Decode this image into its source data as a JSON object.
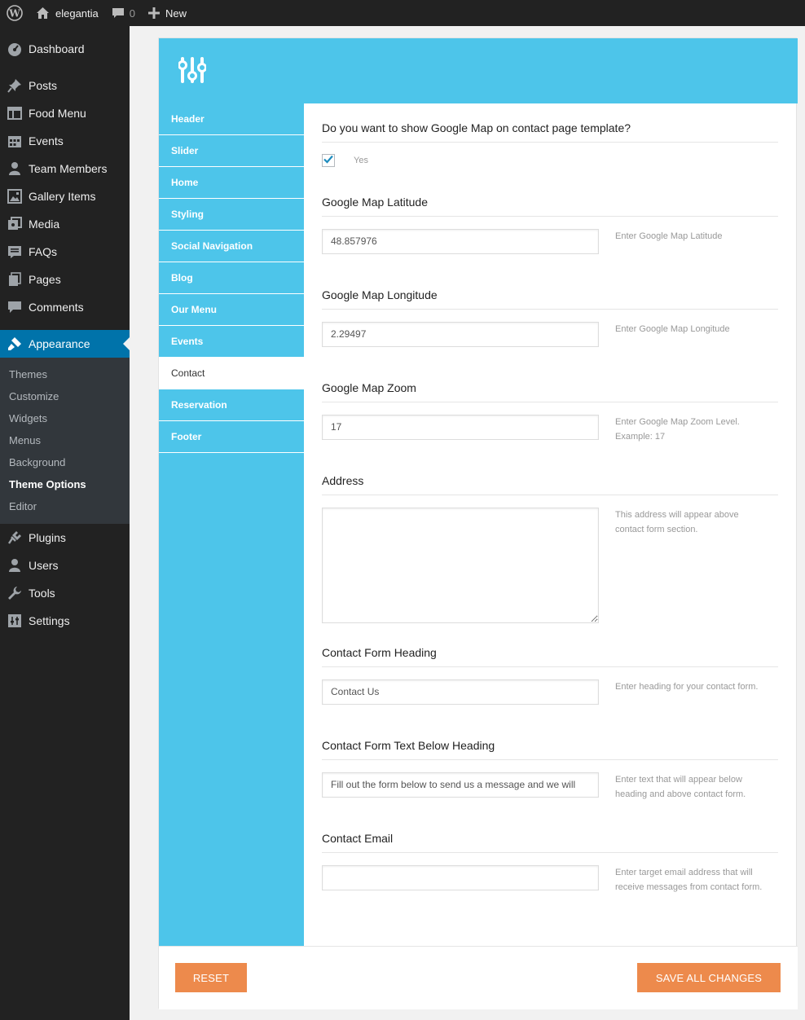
{
  "adminbar": {
    "site_name": "elegantia",
    "comments_count": "0",
    "new_label": "New"
  },
  "sidebar": {
    "items_top": [
      {
        "label": "Dashboard",
        "icon": "dashboard-icon"
      },
      {
        "label": "Posts",
        "icon": "pin-icon"
      },
      {
        "label": "Food Menu",
        "icon": "table-icon"
      },
      {
        "label": "Events",
        "icon": "calendar-icon"
      },
      {
        "label": "Team Members",
        "icon": "person-icon"
      },
      {
        "label": "Gallery Items",
        "icon": "gallery-icon"
      },
      {
        "label": "Media",
        "icon": "media-icon"
      },
      {
        "label": "FAQs",
        "icon": "faq-icon"
      },
      {
        "label": "Pages",
        "icon": "pages-icon"
      },
      {
        "label": "Comments",
        "icon": "comment-icon"
      }
    ],
    "active": {
      "label": "Appearance",
      "icon": "brush-icon"
    },
    "submenu": [
      "Themes",
      "Customize",
      "Widgets",
      "Menus",
      "Background",
      "Theme Options",
      "Editor"
    ],
    "items_bottom": [
      {
        "label": "Plugins",
        "icon": "plug-icon"
      },
      {
        "label": "Users",
        "icon": "users-icon"
      },
      {
        "label": "Tools",
        "icon": "wrench-icon"
      },
      {
        "label": "Settings",
        "icon": "settings-icon"
      }
    ]
  },
  "options_nav": [
    "Header",
    "Slider",
    "Home",
    "Styling",
    "Social Navigation",
    "Blog",
    "Our Menu",
    "Events",
    "Contact",
    "Reservation",
    "Footer"
  ],
  "options_nav_active": "Contact",
  "contact": {
    "map_question": "Do you want to show Google Map on contact page template?",
    "map_checkbox_label": "Yes",
    "latitude_title": "Google Map Latitude",
    "latitude_value": "48.857976",
    "latitude_desc": "Enter Google Map Latitude",
    "longitude_title": "Google Map Longitude",
    "longitude_value": "2.29497",
    "longitude_desc": "Enter Google Map Longitude",
    "zoom_title": "Google Map Zoom",
    "zoom_value": "17",
    "zoom_desc": "Enter Google Map Zoom Level. Example: 17",
    "address_title": "Address",
    "address_value": "",
    "address_desc": "This address will appear above contact form section.",
    "form_heading_title": "Contact Form Heading",
    "form_heading_value": "Contact Us",
    "form_heading_desc": "Enter heading for your contact form.",
    "form_text_title": "Contact Form Text Below Heading",
    "form_text_value": "Fill out the form below to send us a message and we will",
    "form_text_desc": "Enter text that will appear below heading and above contact form.",
    "email_title": "Contact Email",
    "email_value": "",
    "email_desc": "Enter target email address that will receive messages from contact form."
  },
  "footer": {
    "reset_label": "RESET",
    "save_label": "SAVE ALL CHANGES"
  },
  "colors": {
    "accent": "#4dc5ea",
    "button": "#ed8a4c",
    "admin_active": "#0073aa",
    "sidebar_bg": "#222222"
  }
}
